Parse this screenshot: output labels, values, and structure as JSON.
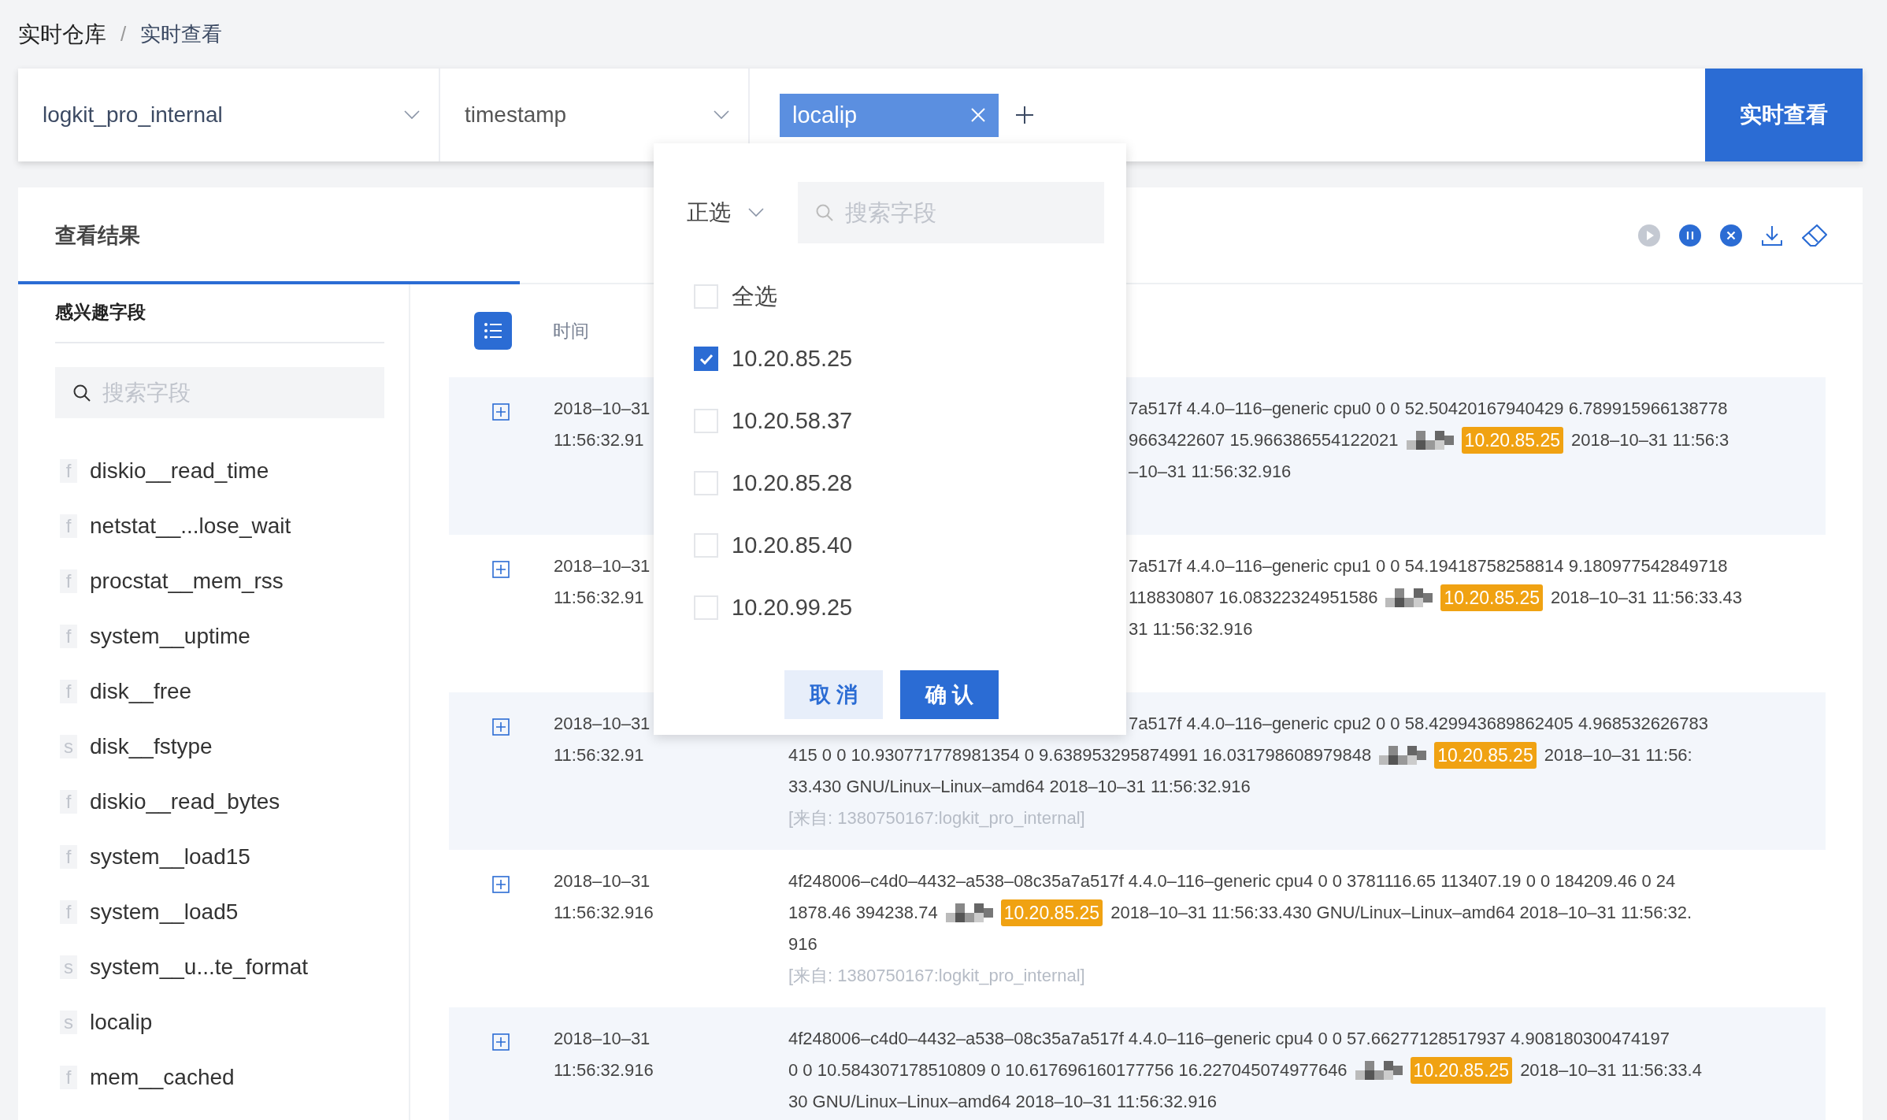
{
  "breadcrumb": {
    "items": [
      {
        "label": "实时仓库"
      },
      {
        "label": "实时查看"
      }
    ],
    "separator": "/"
  },
  "query_bar": {
    "repo": "logkit_pro_internal",
    "time_field": "timestamp",
    "tags": [
      {
        "label": "localip"
      }
    ],
    "submit": "实时查看"
  },
  "results": {
    "title": "查看结果",
    "toolbar": [
      {
        "kind": "play",
        "disabled": true
      },
      {
        "kind": "pause",
        "disabled": false
      },
      {
        "kind": "stop",
        "disabled": false
      },
      {
        "kind": "download",
        "disabled": false
      },
      {
        "kind": "eraser",
        "disabled": false
      }
    ]
  },
  "fields_panel": {
    "title": "感兴趣字段",
    "search_placeholder": "搜索字段",
    "fields": [
      {
        "type": "f",
        "name": "diskio__read_time"
      },
      {
        "type": "f",
        "name": "netstat__...lose_wait"
      },
      {
        "type": "f",
        "name": "procstat__mem_rss"
      },
      {
        "type": "f",
        "name": "system__uptime"
      },
      {
        "type": "f",
        "name": "disk__free"
      },
      {
        "type": "s",
        "name": "disk__fstype"
      },
      {
        "type": "f",
        "name": "diskio__read_bytes"
      },
      {
        "type": "f",
        "name": "system__load15"
      },
      {
        "type": "f",
        "name": "system__load5"
      },
      {
        "type": "s",
        "name": "system__u...te_format"
      },
      {
        "type": "s",
        "name": "localip"
      },
      {
        "type": "f",
        "name": "mem__cached"
      }
    ]
  },
  "log_table": {
    "columns": [
      "时间"
    ],
    "rows": [
      {
        "date": "2018–10–31",
        "time": "11:56:32.91",
        "lines": [
          {
            "covered": true,
            "parts": [
              {
                "kind": "text",
                "text": "7a517f 4.4.0–116–generic cpu0 0 0 52.50420167940429 6.789915966138778"
              }
            ]
          },
          {
            "covered": true,
            "parts": [
              {
                "kind": "text",
                "text": "9663422607 15.966386554122021"
              },
              {
                "kind": "pixelated"
              },
              {
                "kind": "ip",
                "text": "10.20.85.25"
              },
              {
                "kind": "text",
                "text": "2018–10–31 11:56:3"
              }
            ]
          },
          {
            "covered": true,
            "parts": [
              {
                "kind": "text",
                "text": "–10–31 11:56:32.916"
              }
            ]
          }
        ]
      },
      {
        "date": "2018–10–31",
        "time": "11:56:32.91",
        "lines": [
          {
            "covered": true,
            "parts": [
              {
                "kind": "text",
                "text": "7a517f 4.4.0–116–generic cpu1 0 0 54.19418758258814 9.180977542849718"
              }
            ]
          },
          {
            "covered": true,
            "parts": [
              {
                "kind": "text",
                "text": "118830807 16.08322324951586"
              },
              {
                "kind": "pixelated"
              },
              {
                "kind": "ip",
                "text": "10.20.85.25"
              },
              {
                "kind": "text",
                "text": "2018–10–31 11:56:33.43"
              }
            ]
          },
          {
            "covered": true,
            "parts": [
              {
                "kind": "text",
                "text": "31 11:56:32.916"
              }
            ]
          }
        ]
      },
      {
        "date": "2018–10–31",
        "time": "11:56:32.91",
        "lines": [
          {
            "covered": true,
            "parts": [
              {
                "kind": "text",
                "text": "7a517f 4.4.0–116–generic cpu2 0 0 58.429943689862405 4.968532626783"
              }
            ]
          },
          {
            "covered": false,
            "parts": [
              {
                "kind": "text",
                "text": "415 0 0 10.930771778981354 0 9.638953295874991 16.031798608979848"
              },
              {
                "kind": "pixelated"
              },
              {
                "kind": "ip",
                "text": "10.20.85.25"
              },
              {
                "kind": "text",
                "text": "2018–10–31 11:56:"
              }
            ]
          },
          {
            "covered": false,
            "parts": [
              {
                "kind": "text",
                "text": "33.430 GNU/Linux–Linux–amd64 2018–10–31 11:56:32.916"
              }
            ]
          }
        ],
        "source": "[来自: 1380750167:logkit_pro_internal]"
      },
      {
        "date": "2018–10–31",
        "time": "11:56:32.916",
        "lines": [
          {
            "covered": false,
            "parts": [
              {
                "kind": "text",
                "text": "4f248006–c4d0–4432–a538–08c35a7a517f 4.4.0–116–generic cpu4 0 0 3781116.65 113407.19 0 0 184209.46 0 24"
              }
            ]
          },
          {
            "covered": false,
            "parts": [
              {
                "kind": "text",
                "text": "1878.46 394238.74"
              },
              {
                "kind": "pixelated"
              },
              {
                "kind": "ip",
                "text": "10.20.85.25"
              },
              {
                "kind": "text",
                "text": "2018–10–31 11:56:33.430 GNU/Linux–Linux–amd64 2018–10–31 11:56:32."
              }
            ]
          },
          {
            "covered": false,
            "parts": [
              {
                "kind": "text",
                "text": "916"
              }
            ]
          }
        ],
        "source": "[来自: 1380750167:logkit_pro_internal]"
      },
      {
        "date": "2018–10–31",
        "time": "11:56:32.916",
        "lines": [
          {
            "covered": false,
            "parts": [
              {
                "kind": "text",
                "text": "4f248006–c4d0–4432–a538–08c35a7a517f 4.4.0–116–generic cpu4 0 0 57.66277128517937 4.908180300474197"
              }
            ]
          },
          {
            "covered": false,
            "parts": [
              {
                "kind": "text",
                "text": "0 0 10.584307178510809 0 10.617696160177756 16.227045074977646"
              },
              {
                "kind": "pixelated"
              },
              {
                "kind": "ip",
                "text": "10.20.85.25"
              },
              {
                "kind": "text",
                "text": "2018–10–31 11:56:33.4"
              }
            ]
          },
          {
            "covered": false,
            "parts": [
              {
                "kind": "text",
                "text": "30 GNU/Linux–Linux–amd64 2018–10–31 11:56:32.916"
              }
            ]
          }
        ]
      }
    ]
  },
  "filter_popup": {
    "mode": "正选",
    "search_placeholder": "搜索字段",
    "options": [
      {
        "label": "全选",
        "checked": false
      },
      {
        "label": "10.20.85.25",
        "checked": true
      },
      {
        "label": "10.20.58.37",
        "checked": false
      },
      {
        "label": "10.20.85.28",
        "checked": false
      },
      {
        "label": "10.20.85.40",
        "checked": false
      },
      {
        "label": "10.20.99.25",
        "checked": false
      }
    ],
    "buttons": [
      {
        "label": "取 消",
        "kind": "secondary"
      },
      {
        "label": "确 认",
        "kind": "primary"
      }
    ]
  }
}
